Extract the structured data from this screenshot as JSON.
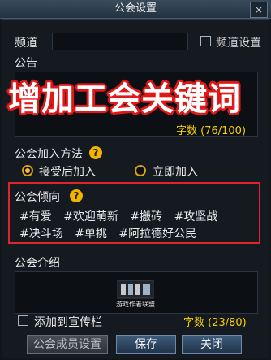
{
  "window": {
    "title": "公会设置",
    "close_label": "×"
  },
  "channel": {
    "label": "频道",
    "setting_label": "频道设置"
  },
  "notice": {
    "label": "公告",
    "char_count": "字数 (76/100)"
  },
  "overlay_text": "增加工会关键词",
  "join": {
    "label": "公会加入方法",
    "help": "?",
    "options": [
      "接受后加入",
      "立即加入"
    ],
    "selected": "接受后加入"
  },
  "tendency": {
    "label": "公会倾向",
    "help": "?",
    "tags_row1": [
      "#有爱",
      "#欢迎萌新",
      "#搬砖",
      "#攻坚战"
    ],
    "tags_row2": [
      "#决斗场",
      "#单挑",
      "#阿拉德好公民"
    ]
  },
  "intro": {
    "label": "公会介绍",
    "logo_text": "游戏作者联盟",
    "char_count": "字数 (23/80)"
  },
  "promo": {
    "label": "添加到宣传栏"
  },
  "buttons": {
    "members": "公会成员设置",
    "save": "保存",
    "close": "关闭"
  },
  "colors": {
    "highlight_border": "#e0242a",
    "count_yellow": "#f5d000",
    "overlay_outline": "#e01818"
  }
}
